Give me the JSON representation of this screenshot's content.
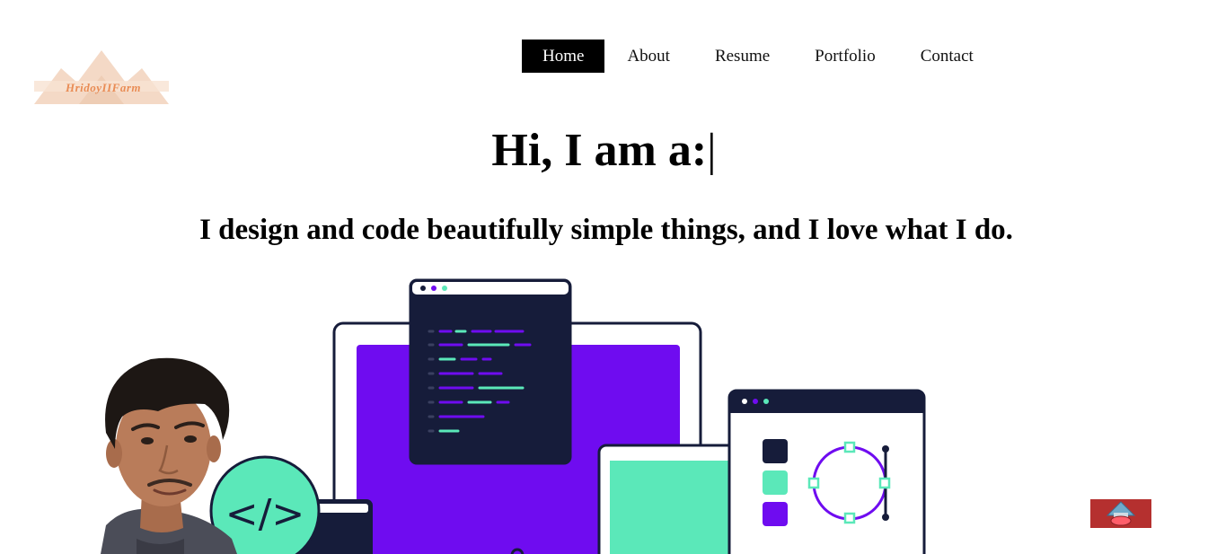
{
  "brand": {
    "logo_text": "HridoyIIFarm"
  },
  "nav": {
    "items": [
      {
        "label": "Home",
        "active": true
      },
      {
        "label": "About",
        "active": false
      },
      {
        "label": "Resume",
        "active": false
      },
      {
        "label": "Portfolio",
        "active": false
      },
      {
        "label": "Contact",
        "active": false
      }
    ]
  },
  "hero": {
    "title": "Hi, I am a:",
    "cursor": "|",
    "subtitle": "I design and code beautifully simple things, and I love what I do."
  },
  "illustration": {
    "code_badge": "</>"
  },
  "colors": {
    "purple": "#6f0cf0",
    "mint": "#5be8b9",
    "navy": "#161c3a",
    "scroll_button": "#b5302f",
    "logo": "#e98c55"
  },
  "icons": {
    "scroll_top": "arrow-up-icon"
  }
}
